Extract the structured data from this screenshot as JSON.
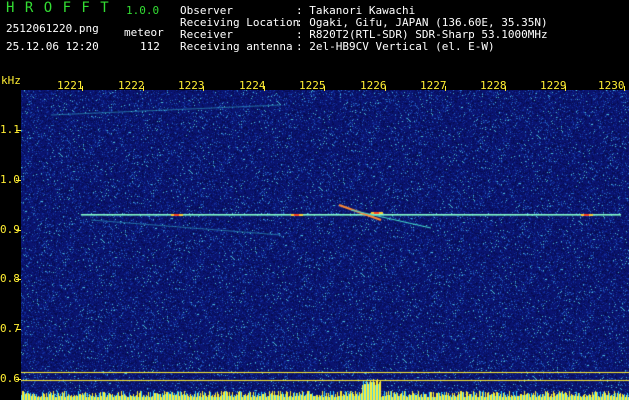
{
  "app": {
    "title_letters": "H R O F F T",
    "version": "1.0.0",
    "filename": "2512061220.png",
    "datetime": "25.12.06 12:20",
    "mode_label": "meteor",
    "count": "112"
  },
  "info": {
    "observer_label": "Observer",
    "observer_value": ": Takanori Kawachi",
    "location_label": "Receiving Location",
    "location_value": ": Ogaki, Gifu, JAPAN (136.60E, 35.35N)",
    "receiver_label": "Receiver",
    "receiver_value": ": R820T2(RTL-SDR) SDR-Sharp 53.1000MHz",
    "antenna_label": "Receiving antenna",
    "antenna_value": ": 2el-HB9CV Vertical (el. E-W)"
  },
  "axis": {
    "y_unit": "kHz",
    "time_ticks": [
      "1221",
      "1222",
      "1223",
      "1224",
      "1225",
      "1226",
      "1227",
      "1228",
      "1229",
      "1230"
    ],
    "freq_ticks": [
      "1.1",
      "1.0",
      "0.9",
      "0.8",
      "0.7",
      "0.6"
    ],
    "freq_values": [
      1.1,
      1.0,
      0.9,
      0.8,
      0.7,
      0.6
    ]
  },
  "colors": {
    "background": "#000000",
    "label_yellow": "#ffee33",
    "title_green": "#33dd33",
    "spectrogram_bg": "#0a1470",
    "carrier_line": "#88ffcc"
  }
}
